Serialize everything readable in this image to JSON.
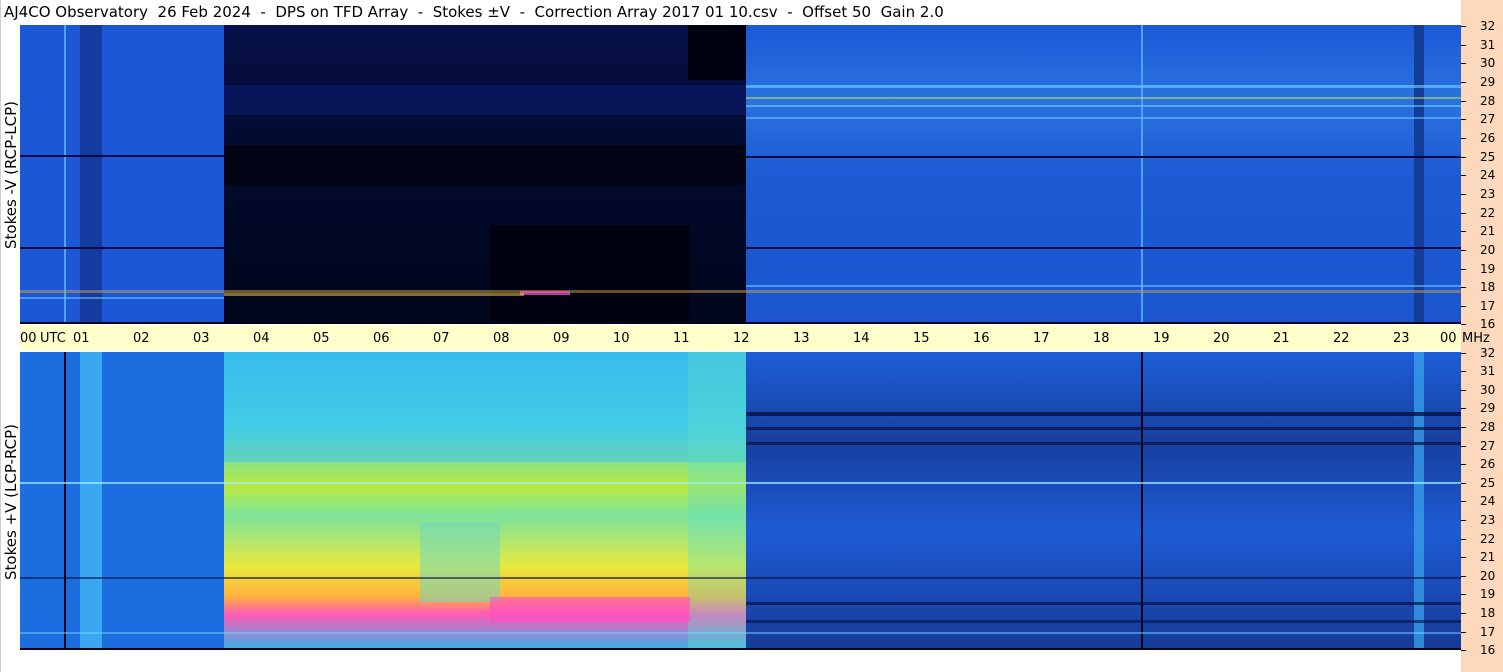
{
  "header": {
    "title": "AJ4CO Observatory  26 Feb 2024  -  DPS on TFD Array  -  Stokes ±V  -  Correction Array 2017 01 10.csv  -  Offset 50  Gain 2.0"
  },
  "chart_data": [
    {
      "type": "heatmap",
      "panel": "top",
      "ylabel": "Stokes -V (RCP-LCP)",
      "x_unit": "UTC",
      "y_unit": "MHz",
      "xlim": [
        0,
        24
      ],
      "ylim": [
        16,
        32
      ],
      "x_tick_labels": [
        "00",
        "01",
        "02",
        "03",
        "04",
        "05",
        "06",
        "07",
        "08",
        "09",
        "10",
        "11",
        "12",
        "13",
        "14",
        "15",
        "16",
        "17",
        "18",
        "19",
        "20",
        "21",
        "22",
        "23",
        "00"
      ],
      "y_tick_labels": [
        "16",
        "17",
        "18",
        "19",
        "20",
        "21",
        "22",
        "23",
        "24",
        "25",
        "26",
        "27",
        "28",
        "29",
        "30",
        "31",
        "32"
      ]
    },
    {
      "type": "heatmap",
      "panel": "bottom",
      "ylabel": "Stokes +V (LCP-RCP)",
      "x_unit": "UTC",
      "y_unit": "MHz",
      "xlim": [
        0,
        24
      ],
      "ylim": [
        16,
        32
      ],
      "x_tick_labels": [
        "00",
        "01",
        "02",
        "03",
        "04",
        "05",
        "06",
        "07",
        "08",
        "09",
        "10",
        "11",
        "12",
        "13",
        "14",
        "15",
        "16",
        "17",
        "18",
        "19",
        "20",
        "21",
        "22",
        "23",
        "00"
      ],
      "y_tick_labels": [
        "16",
        "17",
        "18",
        "19",
        "20",
        "21",
        "22",
        "23",
        "24",
        "25",
        "26",
        "27",
        "28",
        "29",
        "30",
        "31",
        "32"
      ]
    }
  ],
  "axis": {
    "utc_label": "UTC",
    "mhz_label": "MHz"
  },
  "colors": {
    "background": "#ffffff",
    "time_axis_bg": "#ffffcc",
    "freq_axis_bg": "#fcd9bd",
    "heat_low": "#000022",
    "heat_mid": "#1a5fd9",
    "heat_high": "#ff33cc"
  }
}
